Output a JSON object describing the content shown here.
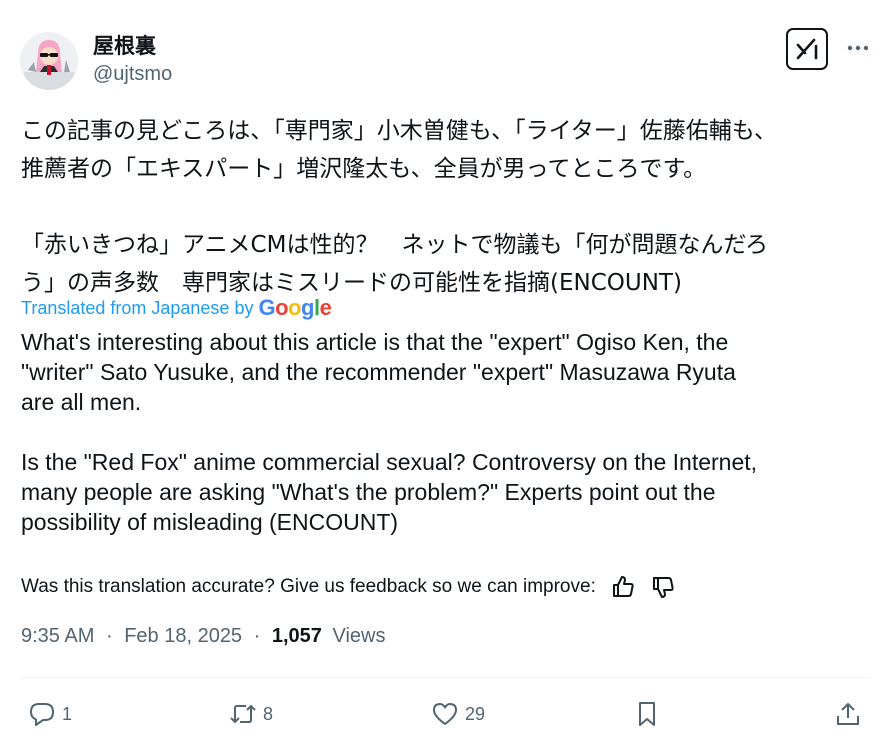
{
  "author": {
    "display_name": "屋根裏",
    "handle": "@ujtsmo"
  },
  "tweet": {
    "text_japanese": "この記事の見どころは、「専門家」小木曽健も、「ライター」佐藤佑輔も、\n推薦者の「エキスパート」増沢隆太も、全員が男ってところです。\n\n「赤いきつね」アニメCMは性的？　ネットで物議も「何が問題なんだろ\nう」の声多数　専門家はミスリードの可能性を指摘(ENCOUNT)",
    "translated_label": "Translated from Japanese by",
    "translated_provider": "Google",
    "text_english": "What's interesting about this article is that the \"expert\" Ogiso Ken, the\n\"writer\" Sato Yusuke, and the recommender \"expert\" Masuzawa Ryuta\nare all men.\n\nIs the \"Red Fox\" anime commercial sexual? Controversy on the Internet,\nmany people are asking \"What's the problem?\" Experts point out the\npossibility of misleading (ENCOUNT)",
    "feedback_prompt": "Was this translation accurate? Give us feedback so we can improve:",
    "time": "9:35 AM",
    "date": "Feb 18, 2025",
    "separator": "·",
    "views_count": "1,057",
    "views_label": "Views"
  },
  "actions": {
    "replies": "1",
    "reposts": "8",
    "likes": "29"
  },
  "icons": {
    "grok": "grok-icon",
    "more": "more-icon",
    "thumbs_up": "thumbs-up-icon",
    "thumbs_down": "thumbs-down-icon",
    "reply": "reply-icon",
    "repost": "repost-icon",
    "like": "heart-icon",
    "bookmark": "bookmark-icon",
    "share": "share-icon"
  },
  "colors": {
    "text": "#0f1419",
    "secondary": "#536471",
    "link": "#1d9bf0"
  }
}
